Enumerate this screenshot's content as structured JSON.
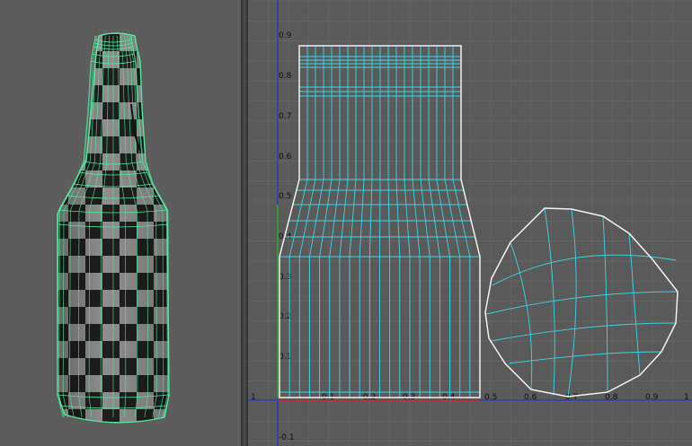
{
  "colors": {
    "viewport_bg": "#5d5d5d",
    "uv_bg": "#5a5a5a",
    "grid": "#6c6c6c",
    "wire_green": "#55e8a0",
    "uv_cyan": "#3ad6e6",
    "shell_outline": "#f2f2f2",
    "axis_v": "#2a33c8",
    "axis_h": "#2a33c8",
    "checker_dark": "#1e1e1e",
    "checker_light": "#8e8e8e"
  },
  "viewport": {
    "object": "bottle-mesh",
    "texture": "checker"
  },
  "uv_editor": {
    "u_ticks": [
      "1",
      "0.1",
      "0.2",
      "0.3",
      "0.4",
      "0.5",
      "0.6",
      "0.7",
      "0.8",
      "0.9",
      "1"
    ],
    "v_ticks": [
      "0.9",
      "0.8",
      "0.7",
      "0.6",
      "0.5",
      "0.4",
      "0.3",
      "0.2",
      "0.1",
      "-0.1"
    ]
  }
}
